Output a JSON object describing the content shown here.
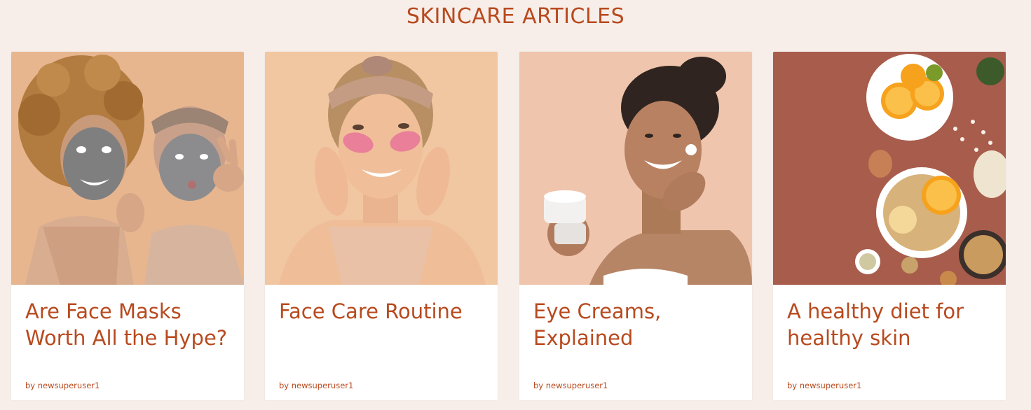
{
  "page": {
    "title": "SKINCARE ARTICLES"
  },
  "articles": [
    {
      "title": "Are Face Masks Worth All the Hype?",
      "author": "by newsuperuser1",
      "image_icon": "two-women-face-masks-photo"
    },
    {
      "title": "Face Care Routine",
      "author": "by newsuperuser1",
      "image_icon": "woman-eye-patches-photo"
    },
    {
      "title": "Eye Creams, Explained",
      "author": "by newsuperuser1",
      "image_icon": "woman-applying-cream-photo"
    },
    {
      "title": "A healthy diet for healthy skin",
      "author": "by newsuperuser1",
      "image_icon": "healthy-food-flatlay-photo"
    }
  ],
  "colors": {
    "background": "#f7eee9",
    "accent": "#b84a1e",
    "card": "#ffffff"
  }
}
